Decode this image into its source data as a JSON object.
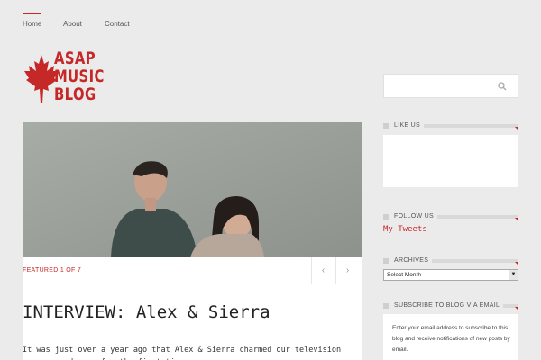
{
  "nav": {
    "items": [
      {
        "label": "Home"
      },
      {
        "label": "About"
      },
      {
        "label": "Contact"
      }
    ]
  },
  "logo": {
    "lines": [
      "ASAP",
      "MUSIC",
      "BLOG"
    ],
    "icon": "maple-leaf-icon",
    "color": "#c62828"
  },
  "slider": {
    "featured": "FEATURED 1 OF 7",
    "prev_icon": "chevron-left-icon",
    "next_icon": "chevron-right-icon"
  },
  "post": {
    "title": "INTERVIEW: Alex & Sierra",
    "excerpt": "It was just over a year ago that Alex & Sierra charmed our television screens and ears for the first time."
  },
  "sidebar": {
    "search": {
      "placeholder": "",
      "icon": "search-icon"
    },
    "like": {
      "title": "LIKE US"
    },
    "follow": {
      "title": "FOLLOW US",
      "link": "My Tweets"
    },
    "archives": {
      "title": "ARCHIVES",
      "selected": "Select Month"
    },
    "subscribe": {
      "title": "SUBSCRIBE TO BLOG VIA EMAIL",
      "text": "Enter your email address to subscribe to this blog and receive notifications of new posts by email."
    }
  },
  "colors": {
    "accent": "#c62828",
    "background": "#ebebeb"
  }
}
